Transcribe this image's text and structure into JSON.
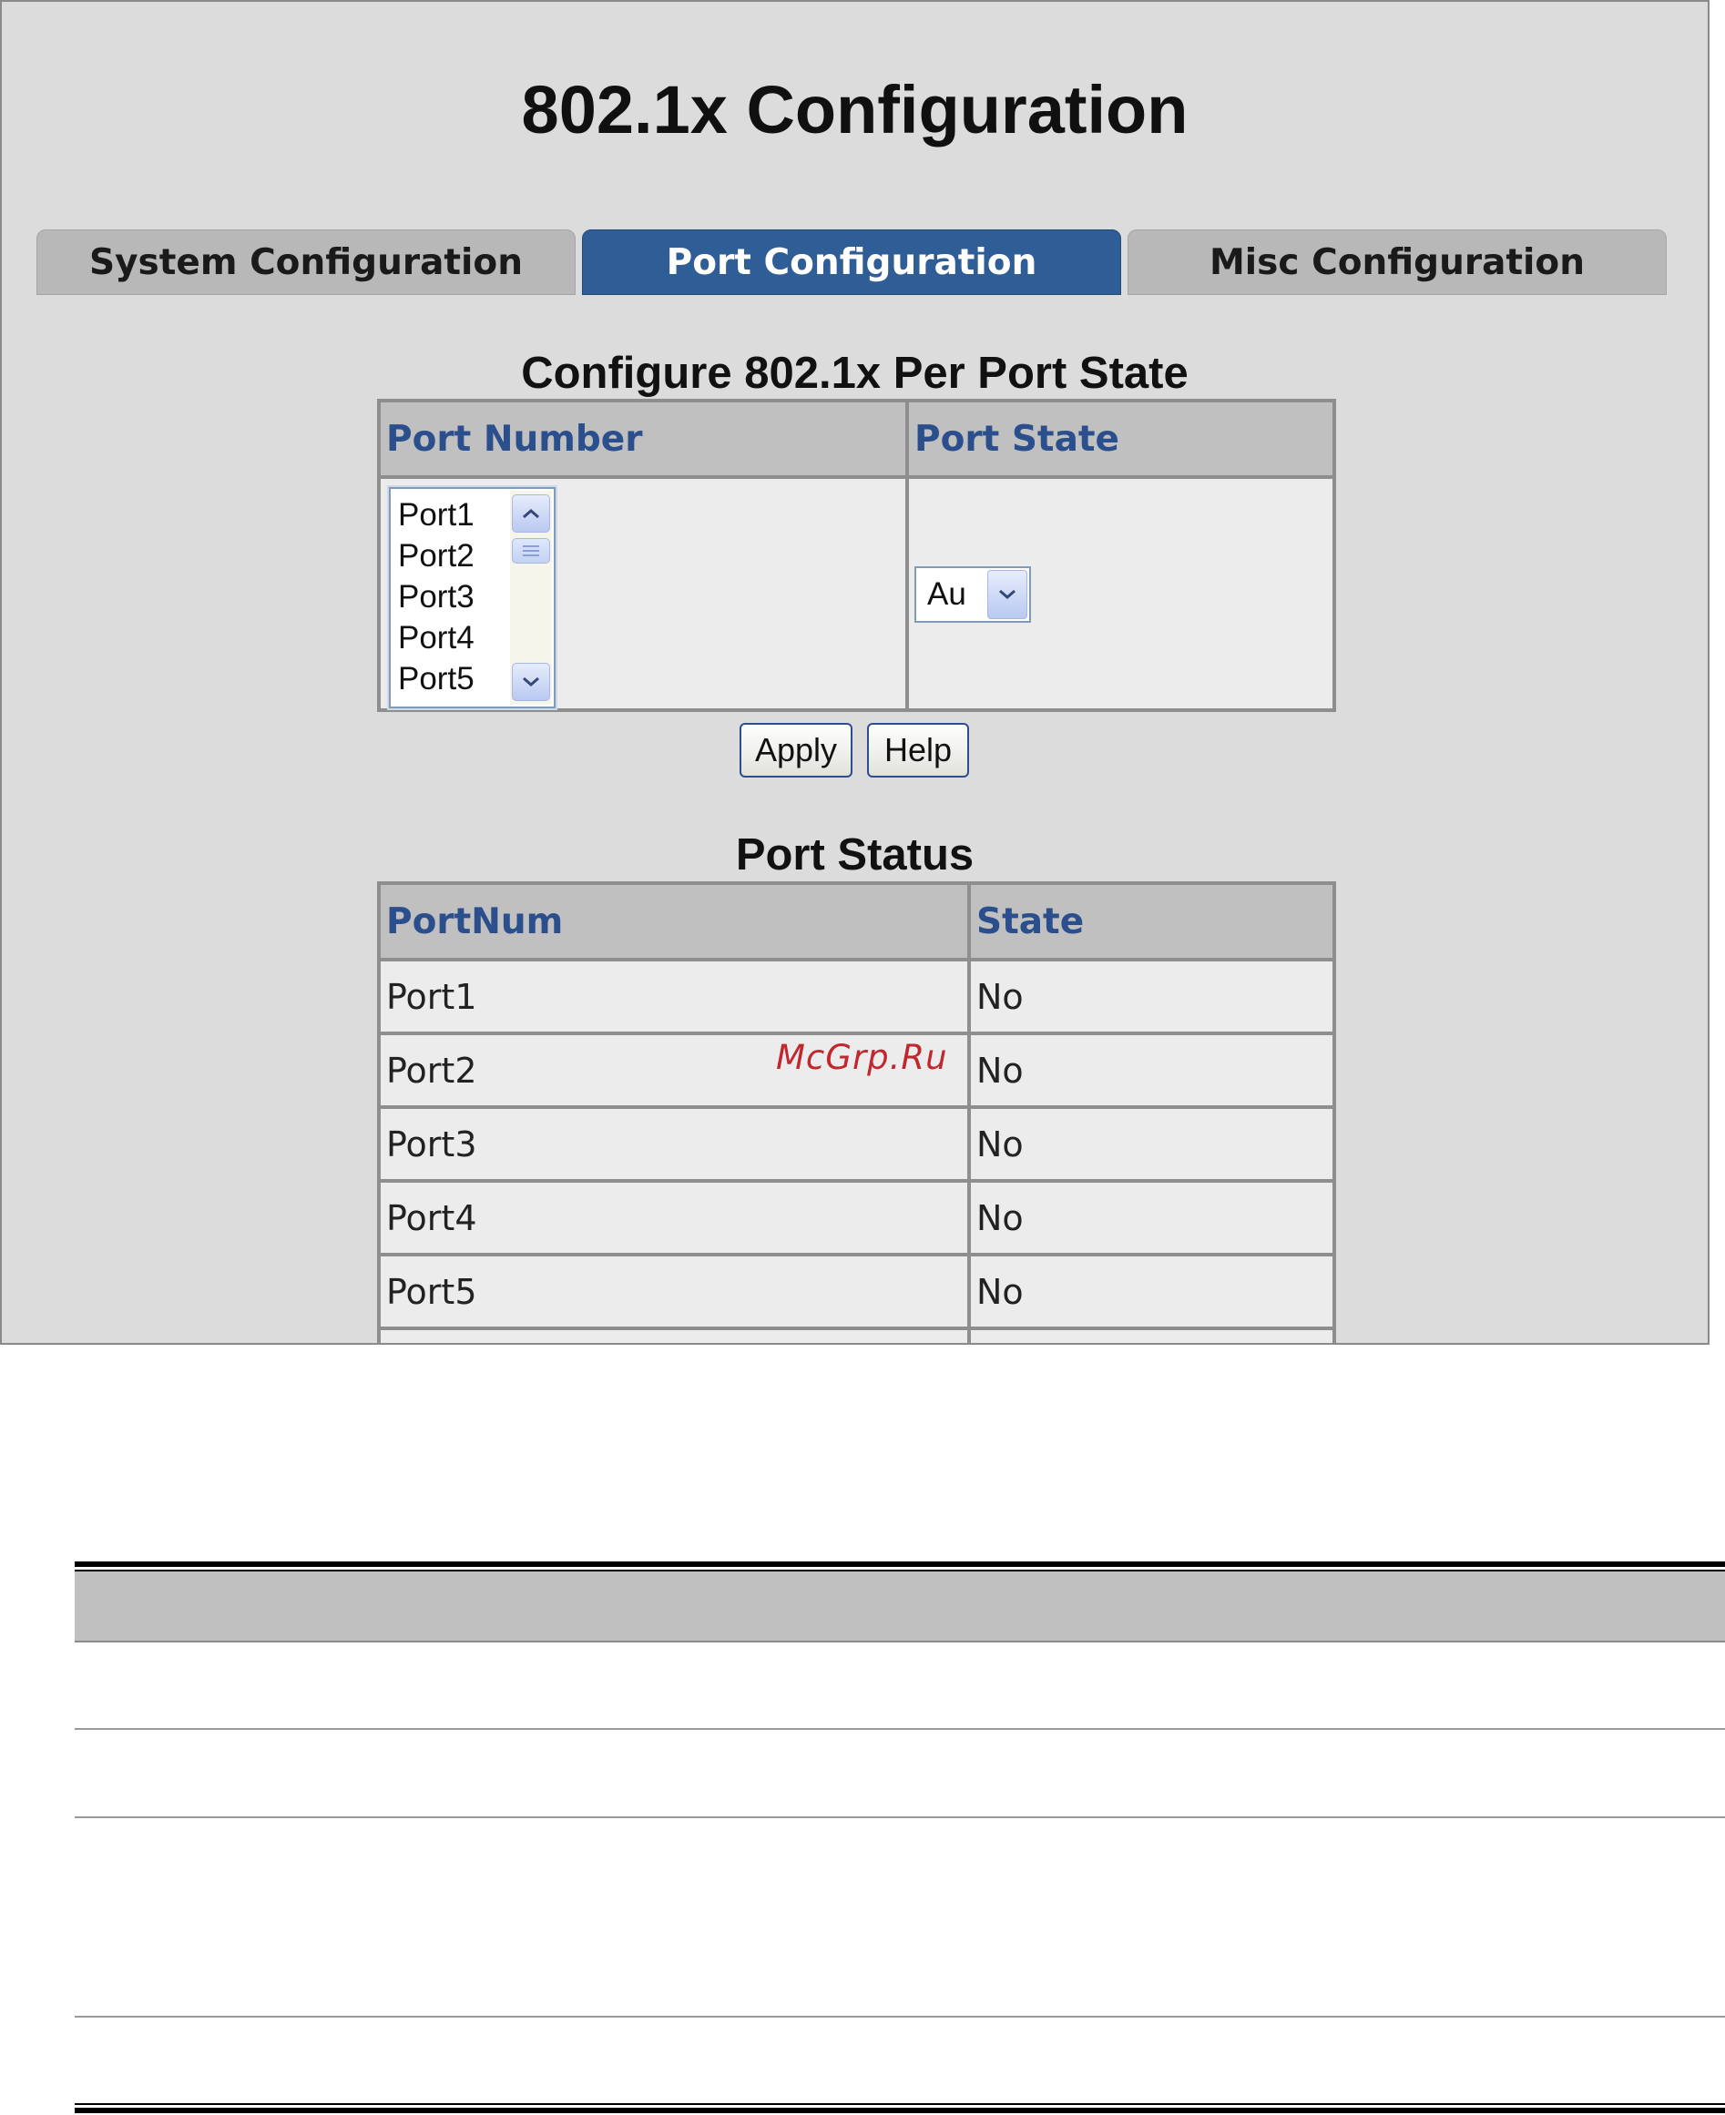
{
  "page": {
    "title": "802.1x Configuration",
    "watermark": "McGrp.Ru"
  },
  "tabs": [
    {
      "label": "System Configuration",
      "active": false
    },
    {
      "label": "Port Configuration",
      "active": true
    },
    {
      "label": "Misc Configuration",
      "active": false
    }
  ],
  "config_section": {
    "title": "Configure 802.1x Per Port State",
    "headers": {
      "port_number": "Port Number",
      "port_state": "Port State"
    },
    "port_list": [
      "Port1",
      "Port2",
      "Port3",
      "Port4",
      "Port5"
    ],
    "state_select_value": "Au",
    "apply_label": "Apply",
    "help_label": "Help"
  },
  "status_section": {
    "title": "Port Status",
    "headers": {
      "portnum": "PortNum",
      "state": "State"
    },
    "rows": [
      {
        "port": "Port1",
        "state": "No"
      },
      {
        "port": "Port2",
        "state": "No"
      },
      {
        "port": "Port3",
        "state": "No"
      },
      {
        "port": "Port4",
        "state": "No"
      },
      {
        "port": "Port5",
        "state": "No"
      }
    ]
  },
  "colors": {
    "active_tab": "#2f5d96",
    "header_text": "#2a4f8c",
    "panel_bg": "#dcdcdc",
    "watermark": "#c0282d"
  },
  "icons": {
    "scroll_up": "chevron-up-icon",
    "scroll_down": "chevron-down-icon",
    "select_arrow": "chevron-down-icon"
  }
}
